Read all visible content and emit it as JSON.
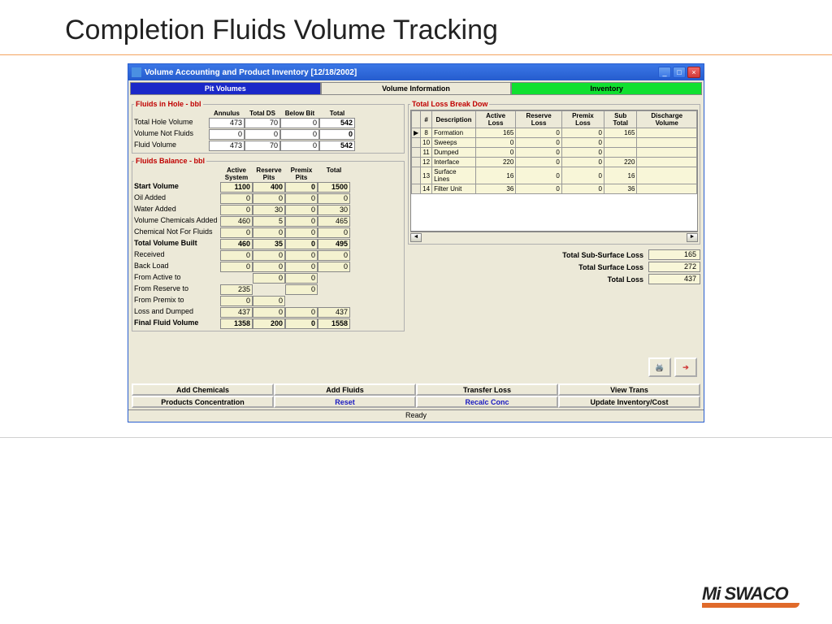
{
  "slide": {
    "title": "Completion Fluids Volume Tracking"
  },
  "window": {
    "title": "Volume Accounting and Product Inventory [12/18/2002]",
    "tabs": {
      "t1": "Pit Volumes",
      "t2": "Volume Information",
      "t3": "Inventory"
    }
  },
  "fluids_in_hole": {
    "legend": "Fluids in Hole - bbl",
    "headers": {
      "c1": "Annulus",
      "c2": "Total DS",
      "c3": "Below Bit",
      "c4": "Total"
    },
    "rows": [
      {
        "label": "Total Hole Volume",
        "v1": "473",
        "v2": "70",
        "v3": "0",
        "v4": "542"
      },
      {
        "label": "Volume Not Fluids",
        "v1": "0",
        "v2": "0",
        "v3": "0",
        "v4": "0"
      },
      {
        "label": "Fluid Volume",
        "v1": "473",
        "v2": "70",
        "v3": "0",
        "v4": "542"
      }
    ]
  },
  "fluids_balance": {
    "legend": "Fluids Balance - bbl",
    "headers": {
      "c1": "Active System",
      "c2": "Reserve Pits",
      "c3": "Premix Pits",
      "c4": "Total"
    },
    "rows": [
      {
        "label": "Start Volume",
        "bold": true,
        "v1": "1100",
        "v2": "400",
        "v3": "0",
        "v4": "1500"
      },
      {
        "label": "Oil Added",
        "v1": "0",
        "v2": "0",
        "v3": "0",
        "v4": "0"
      },
      {
        "label": "Water Added",
        "v1": "0",
        "v2": "30",
        "v3": "0",
        "v4": "30"
      },
      {
        "label": "Volume Chemicals Added",
        "v1": "460",
        "v2": "5",
        "v3": "0",
        "v4": "465"
      },
      {
        "label": "Chemical Not For  Fluids",
        "v1": "0",
        "v2": "0",
        "v3": "0",
        "v4": "0"
      },
      {
        "label": "Total Volume Built",
        "bold": true,
        "v1": "460",
        "v2": "35",
        "v3": "0",
        "v4": "495"
      },
      {
        "label": "Received",
        "v1": "0",
        "v2": "0",
        "v3": "0",
        "v4": "0"
      },
      {
        "label": "Back Load",
        "v1": "0",
        "v2": "0",
        "v3": "0",
        "v4": "0"
      },
      {
        "label": "From Active to",
        "v2": "0",
        "v3": "0"
      },
      {
        "label": "From Reserve to",
        "v1": "235",
        "v3": "0"
      },
      {
        "label": "From Premix to",
        "v1": "0",
        "v2": "0"
      },
      {
        "label": "Loss and Dumped",
        "v1": "437",
        "v2": "0",
        "v3": "0",
        "v4": "437"
      },
      {
        "label": "Final Fluid Volume",
        "bold": true,
        "v1": "1358",
        "v2": "200",
        "v3": "0",
        "v4": "1558"
      }
    ]
  },
  "loss_break": {
    "legend": "Total Loss Break Dow",
    "headers": {
      "h0": "#",
      "h1": "Description",
      "h2": "Active Loss",
      "h3": "Reserve Loss",
      "h4": "Premix Loss",
      "h5": "Sub Total",
      "h6": "Discharge Volume"
    },
    "rows": [
      {
        "n": "8",
        "desc": "Formation",
        "a": "165",
        "r": "0",
        "p": "0",
        "s": "165",
        "d": ""
      },
      {
        "n": "10",
        "desc": "Sweeps",
        "a": "0",
        "r": "0",
        "p": "0",
        "s": "",
        "d": ""
      },
      {
        "n": "11",
        "desc": "Dumped",
        "a": "0",
        "r": "0",
        "p": "0",
        "s": "",
        "d": ""
      },
      {
        "n": "12",
        "desc": "Interface",
        "a": "220",
        "r": "0",
        "p": "0",
        "s": "220",
        "d": ""
      },
      {
        "n": "13",
        "desc": "Surface Lines",
        "a": "16",
        "r": "0",
        "p": "0",
        "s": "16",
        "d": ""
      },
      {
        "n": "14",
        "desc": "Filter Unit",
        "a": "36",
        "r": "0",
        "p": "0",
        "s": "36",
        "d": ""
      }
    ],
    "totals": {
      "sub_surface_label": "Total Sub-Surface Loss",
      "sub_surface": "165",
      "surface_label": "Total Surface Loss",
      "surface": "272",
      "total_label": "Total Loss",
      "total": "437"
    }
  },
  "buttons": {
    "r1": {
      "b1": "Add Chemicals",
      "b2": "Add Fluids",
      "b3": "Transfer Loss",
      "b4": "View Trans"
    },
    "r2": {
      "b1": "Products Concentration",
      "b2": "Reset",
      "b3": "Recalc Conc",
      "b4": "Update Inventory/Cost"
    }
  },
  "status": "Ready",
  "logo": "Mi SWACO"
}
